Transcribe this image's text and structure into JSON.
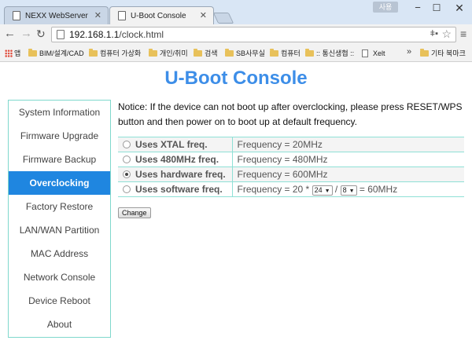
{
  "browser": {
    "tabs": [
      {
        "label": "NEXX WebServer",
        "active": false
      },
      {
        "label": "U-Boot Console",
        "active": true
      }
    ],
    "user_badge": "사용",
    "url_host": "192.168.1.1",
    "url_path": "/clock.html",
    "bookmarks": {
      "apps_label": "앱",
      "items": [
        "BIM/설계/CAD",
        "컴퓨터 가상화",
        "개인/취미",
        "검색",
        "SB사무실",
        "컴퓨터",
        ":: 통신생협 ::",
        "Xelt"
      ],
      "other_label": "기타 북마크"
    }
  },
  "page": {
    "title": "U-Boot Console",
    "notice": "Notice: If the device can not boot up after overclocking, please press RESET/WPS button and then power on to boot up at default frequency.",
    "menu": [
      {
        "label": "System Information",
        "active": false
      },
      {
        "label": "Firmware Upgrade",
        "active": false
      },
      {
        "label": "Firmware Backup",
        "active": false
      },
      {
        "label": "Overclocking",
        "active": true
      },
      {
        "label": "Factory Restore",
        "active": false
      },
      {
        "label": "LAN/WAN Partition",
        "active": false
      },
      {
        "label": "MAC Address",
        "active": false
      },
      {
        "label": "Network Console",
        "active": false
      },
      {
        "label": "Device Reboot",
        "active": false
      },
      {
        "label": "About",
        "active": false
      }
    ],
    "options": [
      {
        "label": "Uses XTAL freq.",
        "value": "Frequency = 20MHz",
        "checked": false
      },
      {
        "label": "Uses 480MHz freq.",
        "value": "Frequency = 480MHz",
        "checked": false
      },
      {
        "label": "Uses hardware freq.",
        "value": "Frequency = 600MHz",
        "checked": true
      },
      {
        "label": "Uses software freq.",
        "value_prefix": "Frequency = 20 *",
        "multiplier": "24",
        "divider_symbol": "/",
        "divider": "8",
        "value_suffix": "= 60MHz",
        "checked": false
      }
    ],
    "change_button": "Change"
  }
}
